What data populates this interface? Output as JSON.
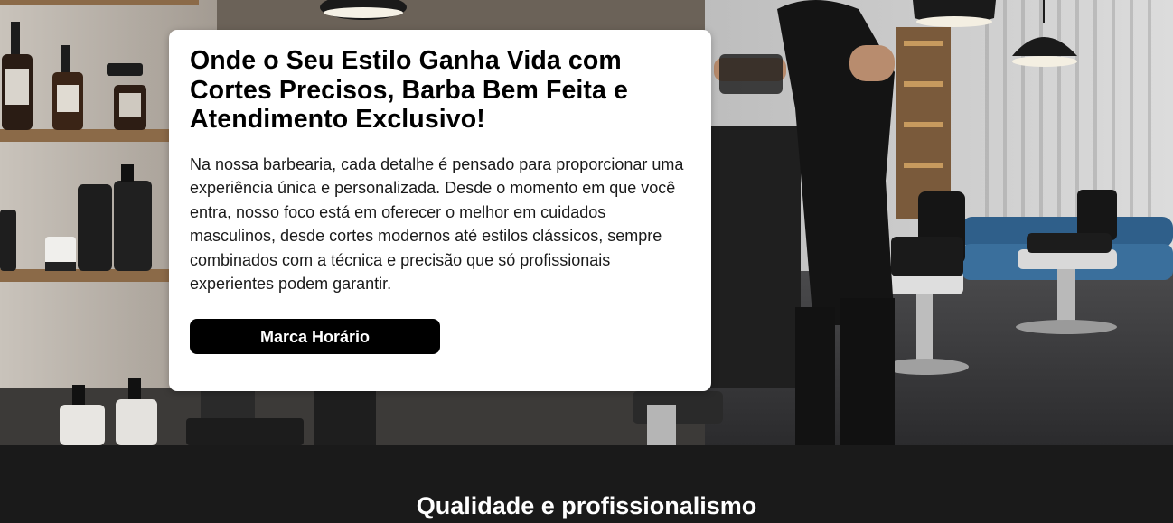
{
  "hero": {
    "title": "Onde o Seu Estilo Ganha Vida com Cortes Precisos, Barba Bem Feita e Atendimento Exclusivo!",
    "description": "Na nossa barbearia, cada detalhe é pensado para proporcionar uma experiência única e personalizada. Desde o momento em que você entra, nosso foco está em oferecer o melhor em cuidados masculinos, desde cortes modernos até estilos clássicos, sempre combinados com a técnica e precisão que só profissionais experientes podem garantir.",
    "cta_label": "Marca Horário",
    "background": "barbershop-interior-photo"
  },
  "section": {
    "heading": "Qualidade e profissionalismo"
  },
  "colors": {
    "button_bg": "#000000",
    "section_bg": "#1a1a1a",
    "card_bg": "#ffffff"
  }
}
